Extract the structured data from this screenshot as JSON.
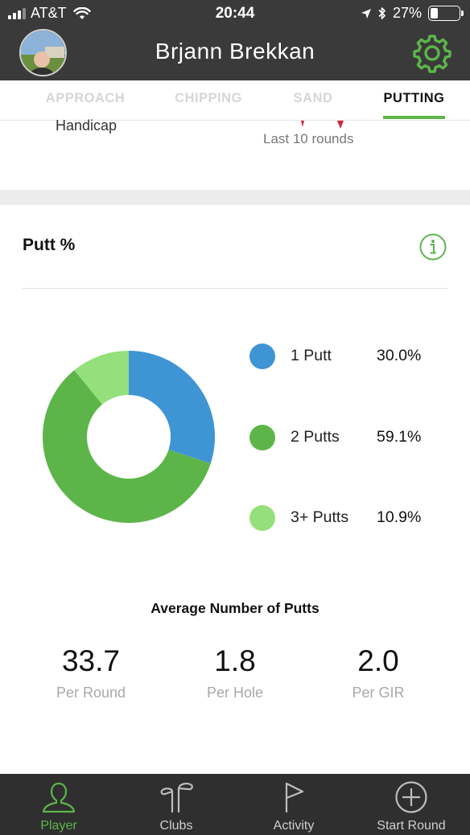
{
  "status_bar": {
    "carrier": "AT&T",
    "time": "20:44",
    "battery": "27%",
    "battery_level": 0.27,
    "icons": [
      "signal-icon",
      "wifi-icon",
      "location-arrow-icon",
      "bluetooth-icon",
      "battery-icon"
    ]
  },
  "header": {
    "user_name": "Brjann Brekkan",
    "avatar": "avatar",
    "settings_icon": "gear-icon"
  },
  "tabs": [
    {
      "label": "APPROACH",
      "active": false
    },
    {
      "label": "CHIPPING",
      "active": false
    },
    {
      "label": "SAND",
      "active": false
    },
    {
      "label": "PUTTING",
      "active": true
    }
  ],
  "summary": {
    "handicap_label": "Handicap",
    "trend_label": "Last 10 rounds"
  },
  "putt_card": {
    "title": "Putt %",
    "info_icon": "info-icon",
    "legend": [
      {
        "label": "1 Putt",
        "value": "30.0%",
        "color": "#3f95d4"
      },
      {
        "label": "2 Putts",
        "value": "59.1%",
        "color": "#5db54a"
      },
      {
        "label": "3+ Putts",
        "value": "10.9%",
        "color": "#94e07a"
      }
    ]
  },
  "chart_data": {
    "type": "pie",
    "title": "Putt %",
    "categories": [
      "1 Putt",
      "2 Putts",
      "3+ Putts"
    ],
    "values": [
      30.0,
      59.1,
      10.9
    ],
    "colors": [
      "#3f95d4",
      "#5db54a",
      "#94e07a"
    ],
    "donut": true,
    "legend_position": "right"
  },
  "averages": {
    "title": "Average Number of Putts",
    "stats": [
      {
        "value": "33.7",
        "label": "Per Round"
      },
      {
        "value": "1.8",
        "label": "Per Hole"
      },
      {
        "value": "2.0",
        "label": "Per GIR"
      }
    ]
  },
  "tab_bar": [
    {
      "label": "Player",
      "icon": "player-icon",
      "active": true
    },
    {
      "label": "Clubs",
      "icon": "clubs-icon",
      "active": false
    },
    {
      "label": "Activity",
      "icon": "flag-icon",
      "active": false
    },
    {
      "label": "Start Round",
      "icon": "plus-circle-icon",
      "active": false
    }
  ],
  "colors": {
    "accent_green": "#5db54a",
    "header_bg": "#3a3a3a",
    "tabbar_bg": "#2f2f2f"
  }
}
